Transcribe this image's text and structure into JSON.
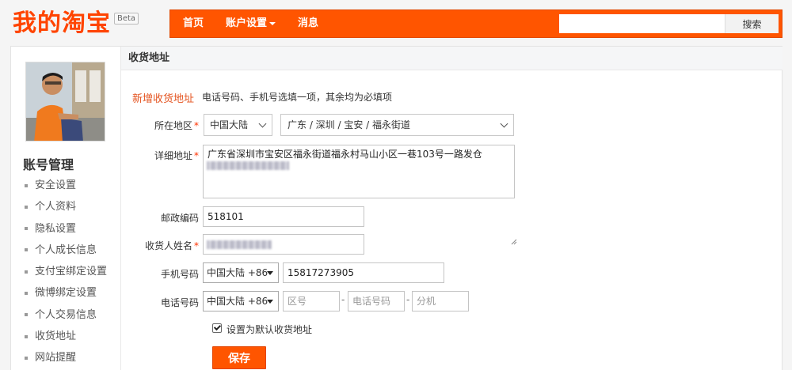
{
  "header": {
    "logo_text": "我的淘宝",
    "beta": "Beta",
    "nav": [
      {
        "label": "首页"
      },
      {
        "label": "账户设置"
      },
      {
        "label": "消息"
      }
    ],
    "search": {
      "value": "",
      "button_label": "搜索"
    },
    "accent_color": "#ff5500"
  },
  "sidebar": {
    "title": "账号管理",
    "items": [
      {
        "label": "安全设置"
      },
      {
        "label": "个人资料"
      },
      {
        "label": "隐私设置"
      },
      {
        "label": "个人成长信息"
      },
      {
        "label": "支付宝绑定设置"
      },
      {
        "label": "微博绑定设置"
      },
      {
        "label": "个人交易信息"
      },
      {
        "label": "收货地址"
      },
      {
        "label": "网站提醒"
      }
    ]
  },
  "content": {
    "section_title": "收货地址",
    "tab_label": "新增收货地址",
    "hint": "电话号码、手机号选填一项，其余均为必填项",
    "region": {
      "label": "所在地区",
      "country": "中国大陆",
      "area": "广东 / 深圳 / 宝安 / 福永街道"
    },
    "detail": {
      "label": "详细地址",
      "value": "广东省深圳市宝安区福永街道福永村马山小区一巷103号一路发仓"
    },
    "postcode": {
      "label": "邮政编码",
      "value": "518101"
    },
    "name": {
      "label": "收货人姓名"
    },
    "mobile": {
      "label": "手机号码",
      "country_code": "中国大陆 +86",
      "value": "15817273905"
    },
    "phone": {
      "label": "电话号码",
      "country_code": "中国大陆 +86",
      "area_placeholder": "区号",
      "number_placeholder": "电话号码",
      "ext_placeholder": "分机"
    },
    "default_checkbox": {
      "label": "设置为默认收货地址",
      "checked": true
    },
    "save_label": "保存"
  }
}
